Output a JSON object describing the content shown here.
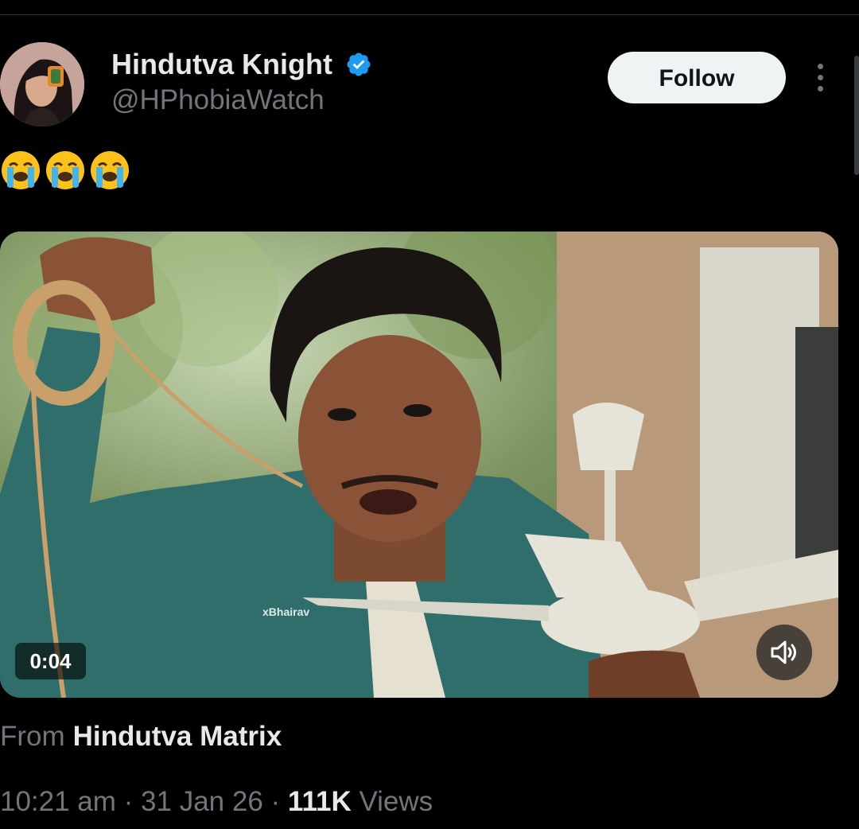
{
  "tweet": {
    "author": {
      "display_name": "Hindutva Knight",
      "handle": "@HPhobiaWatch",
      "verified": true,
      "avatar_icon": "profile-photo-icon"
    },
    "follow_label": "Follow",
    "more_icon": "more-options-icon",
    "text_emojis": [
      "😭",
      "😭",
      "😭"
    ],
    "media": {
      "type": "video",
      "duration": "0:04",
      "watermark": "xBhairav",
      "volume_icon": "volume-muted-icon"
    },
    "source": {
      "prefix": "From",
      "name": "Hindutva Matrix"
    },
    "meta": {
      "time": "10:21 am",
      "date": "31 Jan 26",
      "separator": " · ",
      "views_count": "111K",
      "views_label": " Views"
    }
  },
  "colors": {
    "background": "#000000",
    "primary_text": "#e7e9ea",
    "secondary_text": "#71767b",
    "verified_blue": "#1d9bf0",
    "follow_button_bg": "#eff3f4"
  }
}
